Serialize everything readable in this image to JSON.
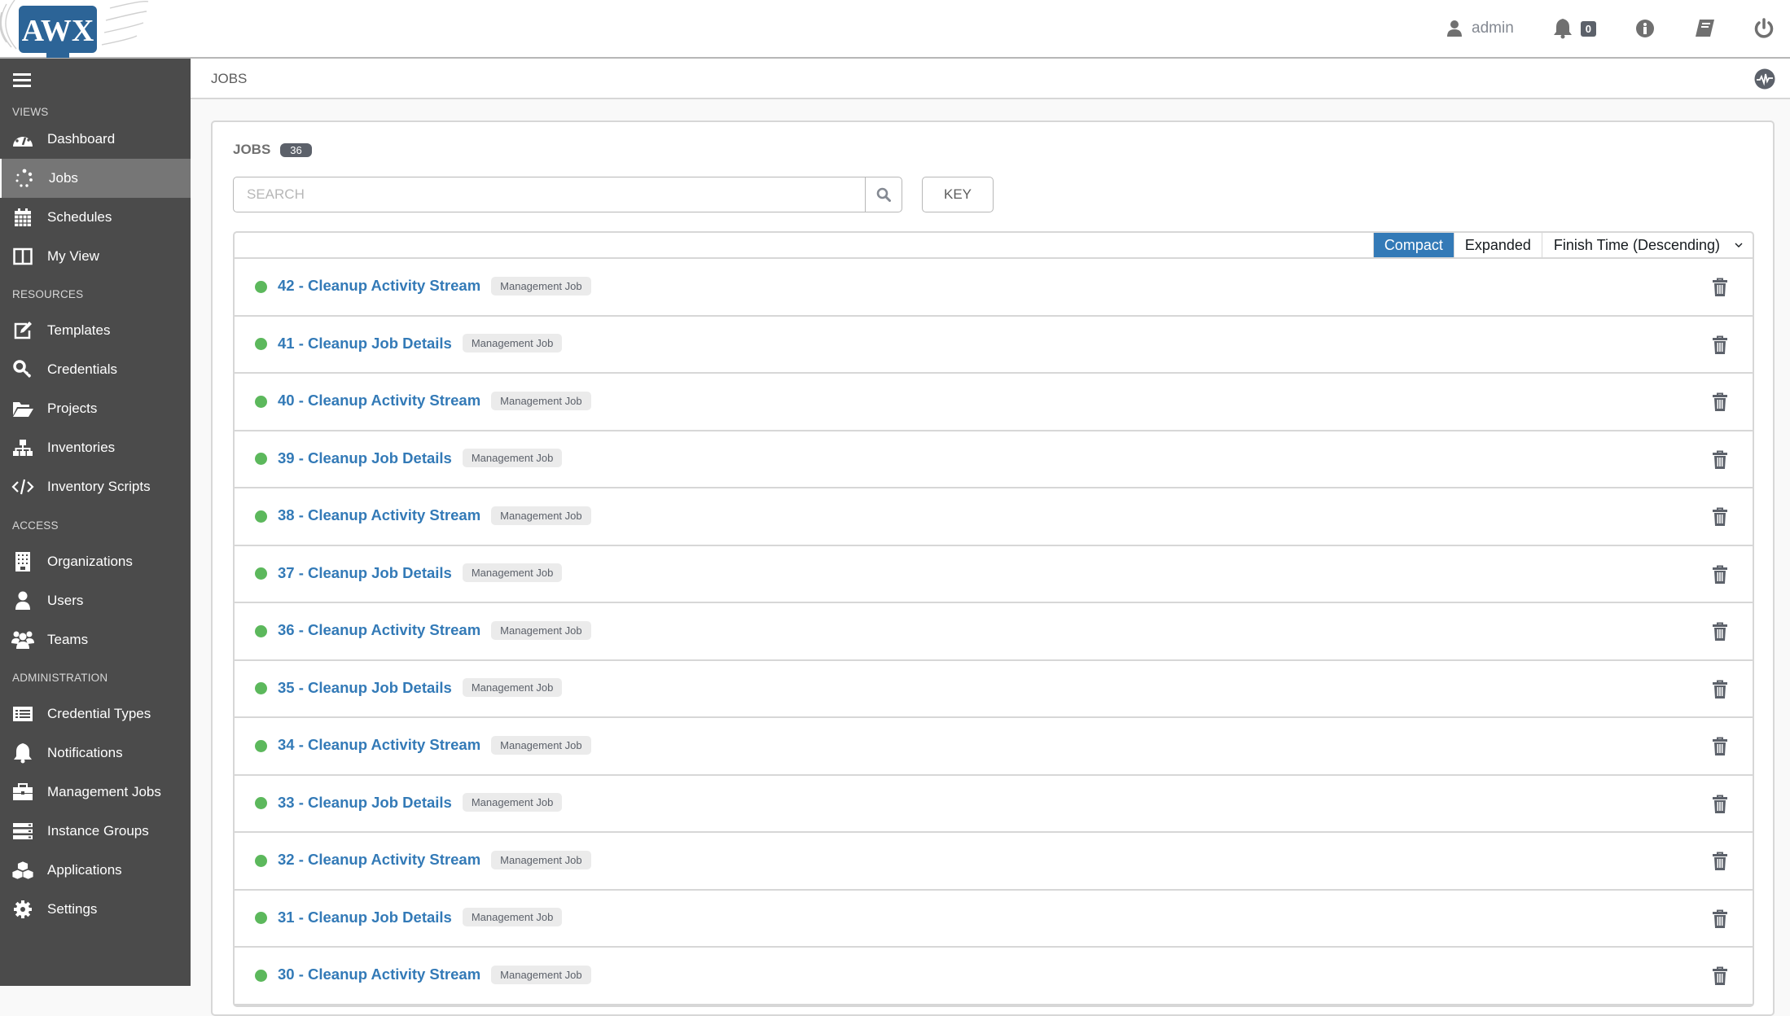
{
  "app": {
    "logo_text": "AWX"
  },
  "header": {
    "user_label": "admin",
    "notification_count": "0"
  },
  "sidebar": {
    "sections": {
      "views": "VIEWS",
      "resources": "RESOURCES",
      "access": "ACCESS",
      "administration": "ADMINISTRATION"
    },
    "items": [
      {
        "label": "Dashboard",
        "icon": "dashboard-icon",
        "active": false
      },
      {
        "label": "Jobs",
        "icon": "jobs-spinner-icon",
        "active": true
      },
      {
        "label": "Schedules",
        "icon": "calendar-icon",
        "active": false
      },
      {
        "label": "My View",
        "icon": "columns-icon",
        "active": false
      },
      {
        "label": "Templates",
        "icon": "edit-icon",
        "active": false
      },
      {
        "label": "Credentials",
        "icon": "key-icon",
        "active": false
      },
      {
        "label": "Projects",
        "icon": "folder-open-icon",
        "active": false
      },
      {
        "label": "Inventories",
        "icon": "sitemap-icon",
        "active": false
      },
      {
        "label": "Inventory Scripts",
        "icon": "code-icon",
        "active": false
      },
      {
        "label": "Organizations",
        "icon": "building-icon",
        "active": false
      },
      {
        "label": "Users",
        "icon": "user-icon",
        "active": false
      },
      {
        "label": "Teams",
        "icon": "users-icon",
        "active": false
      },
      {
        "label": "Credential Types",
        "icon": "list-alt-icon",
        "active": false
      },
      {
        "label": "Notifications",
        "icon": "bell-icon",
        "active": false
      },
      {
        "label": "Management Jobs",
        "icon": "briefcase-icon",
        "active": false
      },
      {
        "label": "Instance Groups",
        "icon": "server-icon",
        "active": false
      },
      {
        "label": "Applications",
        "icon": "cubes-icon",
        "active": false
      },
      {
        "label": "Settings",
        "icon": "cog-icon",
        "active": false
      }
    ]
  },
  "breadcrumb": {
    "current": "JOBS"
  },
  "panel": {
    "title": "JOBS",
    "count": "36",
    "search_placeholder": "SEARCH",
    "key_label": "KEY",
    "view_compact": "Compact",
    "view_expanded": "Expanded",
    "sort_selected": "Finish Time (Descending)"
  },
  "colors": {
    "accent": "#337ab7",
    "success": "#5cb85c",
    "sidebar_bg": "#4b4b4b",
    "sidebar_active": "#767676"
  },
  "jobs": [
    {
      "id": "42",
      "name": "42 - Cleanup Activity Stream",
      "type": "Management Job",
      "status": "successful"
    },
    {
      "id": "41",
      "name": "41 - Cleanup Job Details",
      "type": "Management Job",
      "status": "successful"
    },
    {
      "id": "40",
      "name": "40 - Cleanup Activity Stream",
      "type": "Management Job",
      "status": "successful"
    },
    {
      "id": "39",
      "name": "39 - Cleanup Job Details",
      "type": "Management Job",
      "status": "successful"
    },
    {
      "id": "38",
      "name": "38 - Cleanup Activity Stream",
      "type": "Management Job",
      "status": "successful"
    },
    {
      "id": "37",
      "name": "37 - Cleanup Job Details",
      "type": "Management Job",
      "status": "successful"
    },
    {
      "id": "36",
      "name": "36 - Cleanup Activity Stream",
      "type": "Management Job",
      "status": "successful"
    },
    {
      "id": "35",
      "name": "35 - Cleanup Job Details",
      "type": "Management Job",
      "status": "successful"
    },
    {
      "id": "34",
      "name": "34 - Cleanup Activity Stream",
      "type": "Management Job",
      "status": "successful"
    },
    {
      "id": "33",
      "name": "33 - Cleanup Job Details",
      "type": "Management Job",
      "status": "successful"
    },
    {
      "id": "32",
      "name": "32 - Cleanup Activity Stream",
      "type": "Management Job",
      "status": "successful"
    },
    {
      "id": "31",
      "name": "31 - Cleanup Job Details",
      "type": "Management Job",
      "status": "successful"
    },
    {
      "id": "30",
      "name": "30 - Cleanup Activity Stream",
      "type": "Management Job",
      "status": "successful"
    }
  ]
}
